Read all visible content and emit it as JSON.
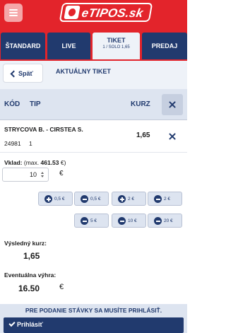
{
  "header": {
    "logo_text": "eTIPOS.sk",
    "brand_color": "#e3242b",
    "nav_color": "#213a6e"
  },
  "tabs": [
    {
      "label": "ŠTANDARD"
    },
    {
      "label": "LIVE"
    },
    {
      "label": "TIKET",
      "sublabel": "1 / SOLO 1,65"
    },
    {
      "label": "PREDAJ"
    }
  ],
  "ticket": {
    "back_label": "Späť",
    "title": "AKTUÁLNY TIKET",
    "columns": {
      "code": "KÓD",
      "tip": "TIP",
      "odds": "KURZ"
    },
    "bet": {
      "match": "STRYCOVA B. - CIRSTEA S.",
      "code": "24981",
      "tip": "1",
      "odds": "1,65"
    },
    "stake": {
      "label": "Vklad:",
      "max_prefix": "(max.",
      "max_value": "461.53",
      "max_suffix": "€)",
      "value": "10",
      "currency": "€"
    },
    "chips": [
      "0,5 €",
      "0,5 €",
      "2 €",
      "2 €",
      "5 €",
      "10 €",
      "20 €"
    ],
    "result_odds": {
      "label": "Výsledný kurz:",
      "value": "1,65"
    },
    "potential_win": {
      "label": "Eventuálna výhra:",
      "value": "16.50",
      "currency": "€"
    }
  },
  "footer": {
    "notice": "PRE PODANIE STÁVKY SA MUSÍTE PRIHLÁSIŤ.",
    "login_label": "Prihlásiť"
  }
}
